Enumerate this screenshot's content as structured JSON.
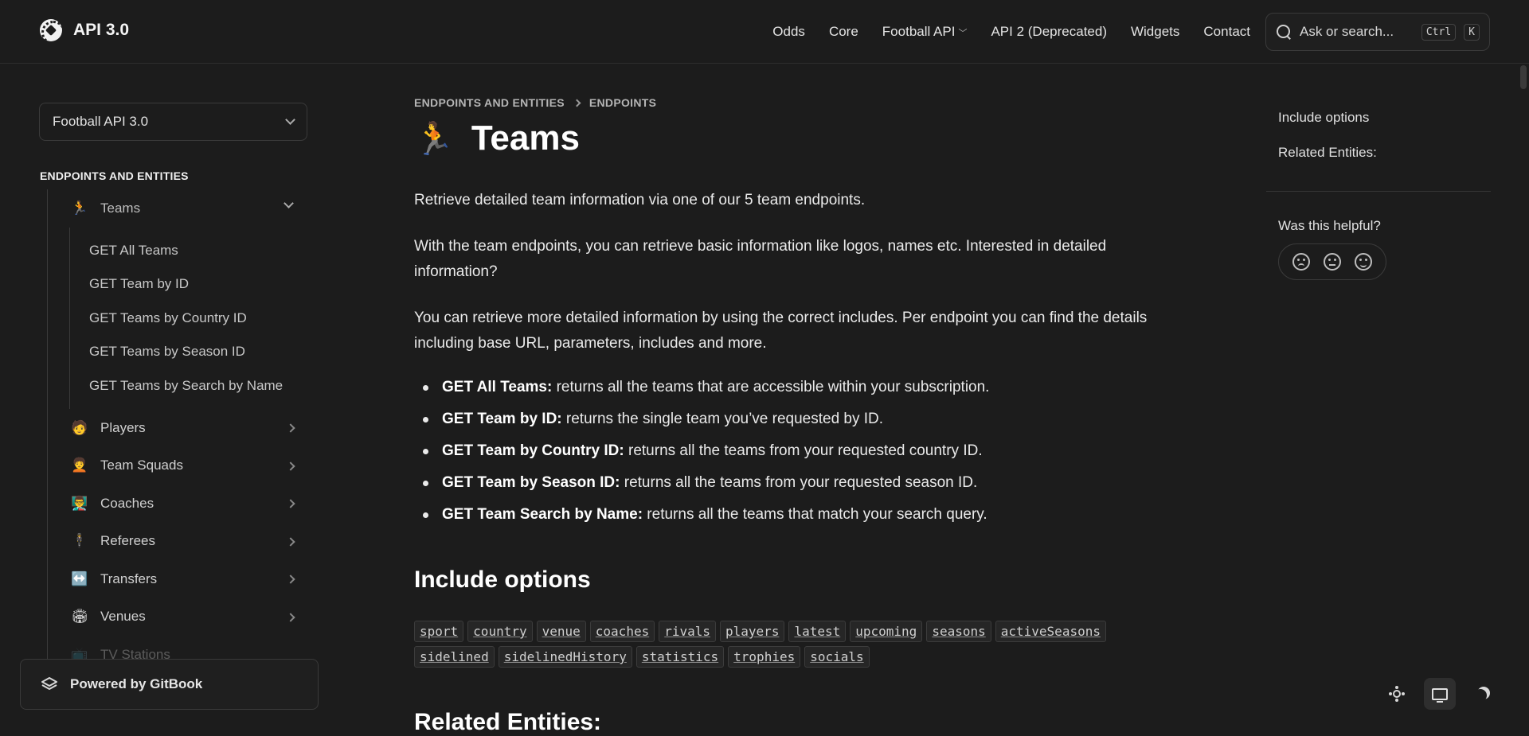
{
  "header": {
    "brand_title": "API 3.0",
    "nav": [
      {
        "label": "Odds"
      },
      {
        "label": "Core"
      },
      {
        "label": "Football API",
        "has_dropdown": true
      },
      {
        "label": "API 2 (Deprecated)"
      },
      {
        "label": "Widgets"
      },
      {
        "label": "Contact"
      }
    ],
    "search": {
      "placeholder": "Ask or search...",
      "shortcut_mod": "Ctrl",
      "shortcut_key": "K"
    }
  },
  "sidebar": {
    "version_select": "Football API 3.0",
    "section_label": "ENDPOINTS AND ENTITIES",
    "items": [
      {
        "emoji": "🏃",
        "label": "Teams",
        "expanded": true,
        "children": [
          "GET All Teams",
          "GET Team by ID",
          "GET Teams by Country ID",
          "GET Teams by Season ID",
          "GET Teams by Search by Name"
        ]
      },
      {
        "emoji": "🧑",
        "label": "Players"
      },
      {
        "emoji": "🧑‍🦱",
        "label": "Team Squads"
      },
      {
        "emoji": "👨‍🏫",
        "label": "Coaches"
      },
      {
        "emoji": "🕴",
        "label": "Referees"
      },
      {
        "emoji": "↔️",
        "label": "Transfers"
      },
      {
        "emoji": "🏟",
        "label": "Venues"
      },
      {
        "emoji": "📺",
        "label": "TV Stations"
      }
    ],
    "powered_by": "Powered by GitBook"
  },
  "main": {
    "breadcrumb": [
      "ENDPOINTS AND ENTITIES",
      "ENDPOINTS"
    ],
    "title_emoji": "🏃",
    "title": "Teams",
    "paragraphs": [
      "Retrieve detailed team information via one of our 5 team endpoints.",
      "With the team endpoints, you can retrieve basic information like logos, names etc. Interested in detailed information?",
      "You can retrieve more detailed information by using the correct includes. Per endpoint you can find the details including base URL, parameters, includes and more."
    ],
    "bullets": [
      {
        "bold": "GET All Teams:",
        "text": " returns all the teams that are accessible within your subscription."
      },
      {
        "bold": "GET Team by ID:",
        "text": " returns the single team you’ve requested by ID."
      },
      {
        "bold": "GET Team by Country ID:",
        "text": " returns all the teams from your requested country ID."
      },
      {
        "bold": "GET Team by Season ID:",
        "text": " returns all the teams from your requested season ID."
      },
      {
        "bold": "GET Team Search by Name:",
        "text": " returns all the teams that match your search query."
      }
    ],
    "include_heading": "Include options",
    "includes": [
      "sport",
      "country",
      "venue",
      "coaches",
      "rivals",
      "players",
      "latest",
      "upcoming",
      "seasons",
      "activeSeasons",
      "sidelined",
      "sidelinedHistory",
      "statistics",
      "trophies",
      "socials"
    ],
    "related_heading": "Related Entities:"
  },
  "toc": {
    "links": [
      "Include options",
      "Related Entities:"
    ],
    "helpful": "Was this helpful?"
  }
}
